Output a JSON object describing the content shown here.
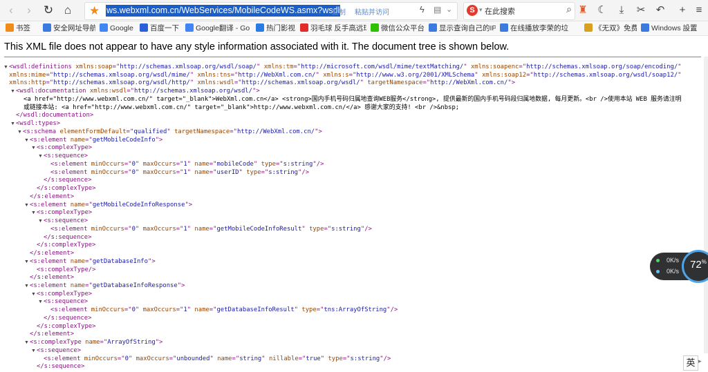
{
  "toolbar": {
    "icons": [
      "back-icon",
      "forward-icon",
      "reload-icon",
      "home-icon",
      "star-icon",
      "bolt-icon",
      "grid-icon",
      "search-icon",
      "game-icon",
      "moon-icon",
      "download-icon",
      "scissors-icon",
      "undo-icon",
      "plus-icon",
      "menu-icon"
    ],
    "url": "ws.webxml.com.cn/WebServices/MobileCodeWS.asmx?wsdl",
    "copy_label": "复制",
    "paste_label": "粘贴并访问",
    "search_placeholder": "在此搜索",
    "search_logo": "S"
  },
  "bookmarks": [
    {
      "label": "书签",
      "icon": "bookmark-star-icon",
      "color": "#f08c1a"
    },
    {
      "label": "安全网址导航",
      "icon": "globe-icon",
      "color": "#3b7be0"
    },
    {
      "label": "Google",
      "icon": "google-icon",
      "color": "#4285f4"
    },
    {
      "label": "百度一下",
      "icon": "baidu-icon",
      "color": "#2b5fd9"
    },
    {
      "label": "Google翻译 - Go",
      "icon": "google-icon",
      "color": "#4285f4"
    },
    {
      "label": "热门影视",
      "icon": "video-icon",
      "color": "#2a7be4"
    },
    {
      "label": "羽毛球 反手高远球",
      "icon": "youtube-icon",
      "color": "#e22b2b"
    },
    {
      "label": "微信公众平台",
      "icon": "wechat-icon",
      "color": "#2dc100"
    },
    {
      "label": "显示查询自己的IP",
      "icon": "globe-icon",
      "color": "#3b7be0"
    },
    {
      "label": "在线播放李荣的垃",
      "icon": "globe-icon",
      "color": "#3b7be0"
    },
    {
      "label": "《无双》免费高清",
      "icon": "video-icon",
      "color": "#d9a21e"
    },
    {
      "label": "Windows 設置",
      "icon": "windows-icon",
      "color": "#3b7be0"
    }
  ],
  "notice": "This XML file does not appear to have any style information associated with it. The document tree is shown below.",
  "xml_lines": [
    {
      "d": 0,
      "t": "▼",
      "p": [
        [
          "t",
          "<wsdl:definitions "
        ],
        [
          "a",
          "xmlns:soap"
        ],
        [
          "t",
          "=\""
        ],
        [
          "v",
          "http://schemas.xmlsoap.org/wsdl/soap/"
        ],
        [
          "t",
          "\" "
        ],
        [
          "a",
          "xmlns:tm"
        ],
        [
          "t",
          "=\""
        ],
        [
          "v",
          "http://microsoft.com/wsdl/mime/textMatching/"
        ],
        [
          "t",
          "\" "
        ],
        [
          "a",
          "xmlns:soapenc"
        ],
        [
          "t",
          "=\""
        ],
        [
          "v",
          "http://schemas.xmlsoap.org/soap/encoding/"
        ],
        [
          "t",
          "\""
        ]
      ]
    },
    {
      "d": 0,
      "t": "",
      "x": 13,
      "p": [
        [
          "a",
          "xmlns:mime"
        ],
        [
          "t",
          "=\""
        ],
        [
          "v",
          "http://schemas.xmlsoap.org/wsdl/mime/"
        ],
        [
          "t",
          "\" "
        ],
        [
          "a",
          "xmlns:tns"
        ],
        [
          "t",
          "=\""
        ],
        [
          "v",
          "http://WebXml.com.cn/"
        ],
        [
          "t",
          "\" "
        ],
        [
          "a",
          "xmlns:s"
        ],
        [
          "t",
          "=\""
        ],
        [
          "v",
          "http://www.w3.org/2001/XMLSchema"
        ],
        [
          "t",
          "\" "
        ],
        [
          "a",
          "xmlns:soap12"
        ],
        [
          "t",
          "=\""
        ],
        [
          "v",
          "http://schemas.xmlsoap.org/wsdl/soap12/"
        ],
        [
          "t",
          "\""
        ]
      ]
    },
    {
      "d": 0,
      "t": "",
      "x": 13,
      "p": [
        [
          "a",
          "xmlns:http"
        ],
        [
          "t",
          "=\""
        ],
        [
          "v",
          "http://schemas.xmlsoap.org/wsdl/http/"
        ],
        [
          "t",
          "\" "
        ],
        [
          "a",
          "xmlns:wsdl"
        ],
        [
          "t",
          "=\""
        ],
        [
          "v",
          "http://schemas.xmlsoap.org/wsdl/"
        ],
        [
          "t",
          "\" "
        ],
        [
          "a",
          "targetNamespace"
        ],
        [
          "t",
          "=\""
        ],
        [
          "v",
          "http://WebXml.com.cn/"
        ],
        [
          "t",
          "\">"
        ]
      ]
    },
    {
      "d": 1,
      "t": "▼",
      "p": [
        [
          "t",
          "<wsdl:documentation "
        ],
        [
          "a",
          "xmlns:wsdl"
        ],
        [
          "t",
          "=\""
        ],
        [
          "v",
          "http://schemas.xmlsoap.org/wsdl/"
        ],
        [
          "t",
          "\">"
        ]
      ]
    },
    {
      "d": 2,
      "t": "",
      "x": 34,
      "p": [
        [
          "x",
          "<a href=\"http://www.webxml.com.cn/\" target=\"_blank\">WebXml.com.cn</a> <strong>国内手机号码归属地查询WEB服务</strong>, 提供最新的国内手机号码段归属地数据, 每月更新。<br />使用本站 WEB 服务请注明"
        ]
      ]
    },
    {
      "d": 2,
      "t": "",
      "x": 34,
      "p": [
        [
          "x",
          "或链接本站: <a href=\"http://www.webxml.com.cn/\" target=\"_blank\">http://www.webxml.com.cn/</a> 感谢大家的支持! <br />&nbsp;"
        ]
      ]
    },
    {
      "d": 1,
      "t": "",
      "p": [
        [
          "t",
          "</wsdl:documentation>"
        ]
      ]
    },
    {
      "d": 1,
      "t": "▼",
      "p": [
        [
          "t",
          "<wsdl:types>"
        ]
      ]
    },
    {
      "d": 2,
      "t": "▼",
      "p": [
        [
          "t",
          "<s:schema "
        ],
        [
          "a",
          "elementFormDefault"
        ],
        [
          "t",
          "=\""
        ],
        [
          "v",
          "qualified"
        ],
        [
          "t",
          "\" "
        ],
        [
          "a",
          "targetNamespace"
        ],
        [
          "t",
          "=\""
        ],
        [
          "v",
          "http://WebXml.com.cn/"
        ],
        [
          "t",
          "\">"
        ]
      ]
    },
    {
      "d": 3,
      "t": "▼",
      "p": [
        [
          "t",
          "<s:element "
        ],
        [
          "a",
          "name"
        ],
        [
          "t",
          "=\""
        ],
        [
          "v",
          "getMobileCodeInfo"
        ],
        [
          "t",
          "\">"
        ]
      ]
    },
    {
      "d": 4,
      "t": "▼",
      "p": [
        [
          "t",
          "<s:complexType>"
        ]
      ]
    },
    {
      "d": 5,
      "t": "▼",
      "p": [
        [
          "t",
          "<s:sequence>"
        ]
      ]
    },
    {
      "d": 6,
      "t": "",
      "p": [
        [
          "t",
          "<s:element "
        ],
        [
          "a",
          "minOccurs"
        ],
        [
          "t",
          "=\""
        ],
        [
          "v",
          "0"
        ],
        [
          "t",
          "\" "
        ],
        [
          "a",
          "maxOccurs"
        ],
        [
          "t",
          "=\""
        ],
        [
          "v",
          "1"
        ],
        [
          "t",
          "\" "
        ],
        [
          "a",
          "name"
        ],
        [
          "t",
          "=\""
        ],
        [
          "v",
          "mobileCode"
        ],
        [
          "t",
          "\" "
        ],
        [
          "a",
          "type"
        ],
        [
          "t",
          "=\""
        ],
        [
          "v",
          "s:string"
        ],
        [
          "t",
          "\"/>"
        ]
      ]
    },
    {
      "d": 6,
      "t": "",
      "p": [
        [
          "t",
          "<s:element "
        ],
        [
          "a",
          "minOccurs"
        ],
        [
          "t",
          "=\""
        ],
        [
          "v",
          "0"
        ],
        [
          "t",
          "\" "
        ],
        [
          "a",
          "maxOccurs"
        ],
        [
          "t",
          "=\""
        ],
        [
          "v",
          "1"
        ],
        [
          "t",
          "\" "
        ],
        [
          "a",
          "name"
        ],
        [
          "t",
          "=\""
        ],
        [
          "v",
          "userID"
        ],
        [
          "t",
          "\" "
        ],
        [
          "a",
          "type"
        ],
        [
          "t",
          "=\""
        ],
        [
          "v",
          "s:string"
        ],
        [
          "t",
          "\"/>"
        ]
      ]
    },
    {
      "d": 5,
      "t": "",
      "p": [
        [
          "t",
          "</s:sequence>"
        ]
      ]
    },
    {
      "d": 4,
      "t": "",
      "p": [
        [
          "t",
          "</s:complexType>"
        ]
      ]
    },
    {
      "d": 3,
      "t": "",
      "p": [
        [
          "t",
          "</s:element>"
        ]
      ]
    },
    {
      "d": 3,
      "t": "▼",
      "p": [
        [
          "t",
          "<s:element "
        ],
        [
          "a",
          "name"
        ],
        [
          "t",
          "=\""
        ],
        [
          "v",
          "getMobileCodeInfoResponse"
        ],
        [
          "t",
          "\">"
        ]
      ]
    },
    {
      "d": 4,
      "t": "▼",
      "p": [
        [
          "t",
          "<s:complexType>"
        ]
      ]
    },
    {
      "d": 5,
      "t": "▼",
      "p": [
        [
          "t",
          "<s:sequence>"
        ]
      ]
    },
    {
      "d": 6,
      "t": "",
      "p": [
        [
          "t",
          "<s:element "
        ],
        [
          "a",
          "minOccurs"
        ],
        [
          "t",
          "=\""
        ],
        [
          "v",
          "0"
        ],
        [
          "t",
          "\" "
        ],
        [
          "a",
          "maxOccurs"
        ],
        [
          "t",
          "=\""
        ],
        [
          "v",
          "1"
        ],
        [
          "t",
          "\" "
        ],
        [
          "a",
          "name"
        ],
        [
          "t",
          "=\""
        ],
        [
          "v",
          "getMobileCodeInfoResult"
        ],
        [
          "t",
          "\" "
        ],
        [
          "a",
          "type"
        ],
        [
          "t",
          "=\""
        ],
        [
          "v",
          "s:string"
        ],
        [
          "t",
          "\"/>"
        ]
      ]
    },
    {
      "d": 5,
      "t": "",
      "p": [
        [
          "t",
          "</s:sequence>"
        ]
      ]
    },
    {
      "d": 4,
      "t": "",
      "p": [
        [
          "t",
          "</s:complexType>"
        ]
      ]
    },
    {
      "d": 3,
      "t": "",
      "p": [
        [
          "t",
          "</s:element>"
        ]
      ]
    },
    {
      "d": 3,
      "t": "▼",
      "p": [
        [
          "t",
          "<s:element "
        ],
        [
          "a",
          "name"
        ],
        [
          "t",
          "=\""
        ],
        [
          "v",
          "getDatabaseInfo"
        ],
        [
          "t",
          "\">"
        ]
      ]
    },
    {
      "d": 4,
      "t": "",
      "p": [
        [
          "t",
          "<s:complexType/>"
        ]
      ]
    },
    {
      "d": 3,
      "t": "",
      "p": [
        [
          "t",
          "</s:element>"
        ]
      ]
    },
    {
      "d": 3,
      "t": "▼",
      "p": [
        [
          "t",
          "<s:element "
        ],
        [
          "a",
          "name"
        ],
        [
          "t",
          "=\""
        ],
        [
          "v",
          "getDatabaseInfoResponse"
        ],
        [
          "t",
          "\">"
        ]
      ]
    },
    {
      "d": 4,
      "t": "▼",
      "p": [
        [
          "t",
          "<s:complexType>"
        ]
      ]
    },
    {
      "d": 5,
      "t": "▼",
      "p": [
        [
          "t",
          "<s:sequence>"
        ]
      ]
    },
    {
      "d": 6,
      "t": "",
      "p": [
        [
          "t",
          "<s:element "
        ],
        [
          "a",
          "minOccurs"
        ],
        [
          "t",
          "=\""
        ],
        [
          "v",
          "0"
        ],
        [
          "t",
          "\" "
        ],
        [
          "a",
          "maxOccurs"
        ],
        [
          "t",
          "=\""
        ],
        [
          "v",
          "1"
        ],
        [
          "t",
          "\" "
        ],
        [
          "a",
          "name"
        ],
        [
          "t",
          "=\""
        ],
        [
          "v",
          "getDatabaseInfoResult"
        ],
        [
          "t",
          "\" "
        ],
        [
          "a",
          "type"
        ],
        [
          "t",
          "=\""
        ],
        [
          "v",
          "tns:ArrayOfString"
        ],
        [
          "t",
          "\"/>"
        ]
      ]
    },
    {
      "d": 5,
      "t": "",
      "p": [
        [
          "t",
          "</s:sequence>"
        ]
      ]
    },
    {
      "d": 4,
      "t": "",
      "p": [
        [
          "t",
          "</s:complexType>"
        ]
      ]
    },
    {
      "d": 3,
      "t": "",
      "p": [
        [
          "t",
          "</s:element>"
        ]
      ]
    },
    {
      "d": 3,
      "t": "▼",
      "p": [
        [
          "t",
          "<s:complexType "
        ],
        [
          "a",
          "name"
        ],
        [
          "t",
          "=\""
        ],
        [
          "v",
          "ArrayOfString"
        ],
        [
          "t",
          "\">"
        ]
      ]
    },
    {
      "d": 4,
      "t": "▼",
      "p": [
        [
          "t",
          "<s:sequence>"
        ]
      ]
    },
    {
      "d": 5,
      "t": "",
      "p": [
        [
          "t",
          "<s:element "
        ],
        [
          "a",
          "minOccurs"
        ],
        [
          "t",
          "=\""
        ],
        [
          "v",
          "0"
        ],
        [
          "t",
          "\" "
        ],
        [
          "a",
          "maxOccurs"
        ],
        [
          "t",
          "=\""
        ],
        [
          "v",
          "unbounded"
        ],
        [
          "t",
          "\" "
        ],
        [
          "a",
          "name"
        ],
        [
          "t",
          "=\""
        ],
        [
          "v",
          "string"
        ],
        [
          "t",
          "\" "
        ],
        [
          "a",
          "nillable"
        ],
        [
          "t",
          "=\""
        ],
        [
          "v",
          "true"
        ],
        [
          "t",
          "\" "
        ],
        [
          "a",
          "type"
        ],
        [
          "t",
          "=\""
        ],
        [
          "v",
          "s:string"
        ],
        [
          "t",
          "\"/>"
        ]
      ]
    },
    {
      "d": 4,
      "t": "",
      "p": [
        [
          "t",
          "</s:sequence>"
        ]
      ]
    }
  ],
  "widgets": {
    "up_speed": "0K/s",
    "down_speed": "0K/s",
    "cpu_percent": "72",
    "cpu_unit": "%",
    "ime_label": "英"
  }
}
